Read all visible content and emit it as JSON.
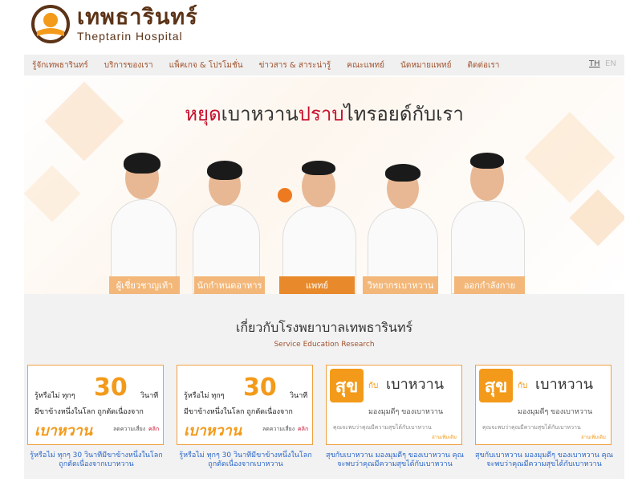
{
  "brand": {
    "name_thai": "เทพธารินทร์",
    "name_en": "Theptarin Hospital"
  },
  "nav": {
    "items": [
      "รู้จักเทพธารินทร์",
      "บริการของเรา",
      "แพ็คเกจ & โปรโมชั่น",
      "ข่าวสาร & สาระน่ารู้",
      "คณะแพทย์",
      "นัดหมายแพทย์",
      "ติดต่อเรา"
    ],
    "lang_th": "TH",
    "lang_en": "EN"
  },
  "banner": {
    "title_part1": "หยุด",
    "title_part2": "เบาหวาน",
    "title_part3": "ปราบ",
    "title_part4": "ไทรอยด์กับเรา",
    "tabs": [
      "ผู้เชี่ยวชาญเท้า",
      "นักกำหนดอาหาร",
      "แพทย์",
      "วิทยากรเบาหวาน",
      "ออกกำลังกาย"
    ]
  },
  "about": {
    "title": "เกี่ยวกับโรงพยาบาลเทพธารินทร์",
    "subtitle": "Service Education Research",
    "fact_card": {
      "line1": "รู้หรือไม่ ทุกๆ",
      "number": "30",
      "unit": "วินาที",
      "line2": "มีขาข้างหนึ่งในโลก ถูกตัดเนื่องจาก",
      "big": "เบาหวาน",
      "small": "ลดความเสี่ยง",
      "click": "คลิก"
    },
    "suk_card": {
      "badge": "สุข",
      "with": "กับ",
      "word": "เบาหวาน",
      "line1": "มองมุมดีๆ ของเบาหวาน",
      "line2": "คุณจะพบว่าคุณมีความสุขได้กับเบาหวาน",
      "more": "อ่านเพิ่มเติม"
    },
    "captions": [
      "รู้หรือไม่ ทุกๆ 30 วินาทีมีขาข้างหนึ่งในโลกถูกตัดเนื่องจากเบาหวาน",
      "รู้หรือไม่ ทุกๆ 30 วินาทีมีขาข้างหนึ่งในโลกถูกตัดเนื่องจากเบาหวาน",
      "สุขกับเบาหวาน มองมุมดีๆ ของเบาหวาน คุณจะพบว่าคุณมีความสุขได้กับเบาหวาน",
      "สุขกับเบาหวาน มองมุมดีๆ ของเบาหวาน คุณจะพบว่าคุณมีความสุขได้กับเบาหวาน"
    ]
  },
  "colors": {
    "brand_brown": "#5c3317",
    "accent_orange": "#f39a1a",
    "tab_orange": "#f3b779",
    "title_red": "#c8102e",
    "link_blue": "#2a66c8"
  }
}
